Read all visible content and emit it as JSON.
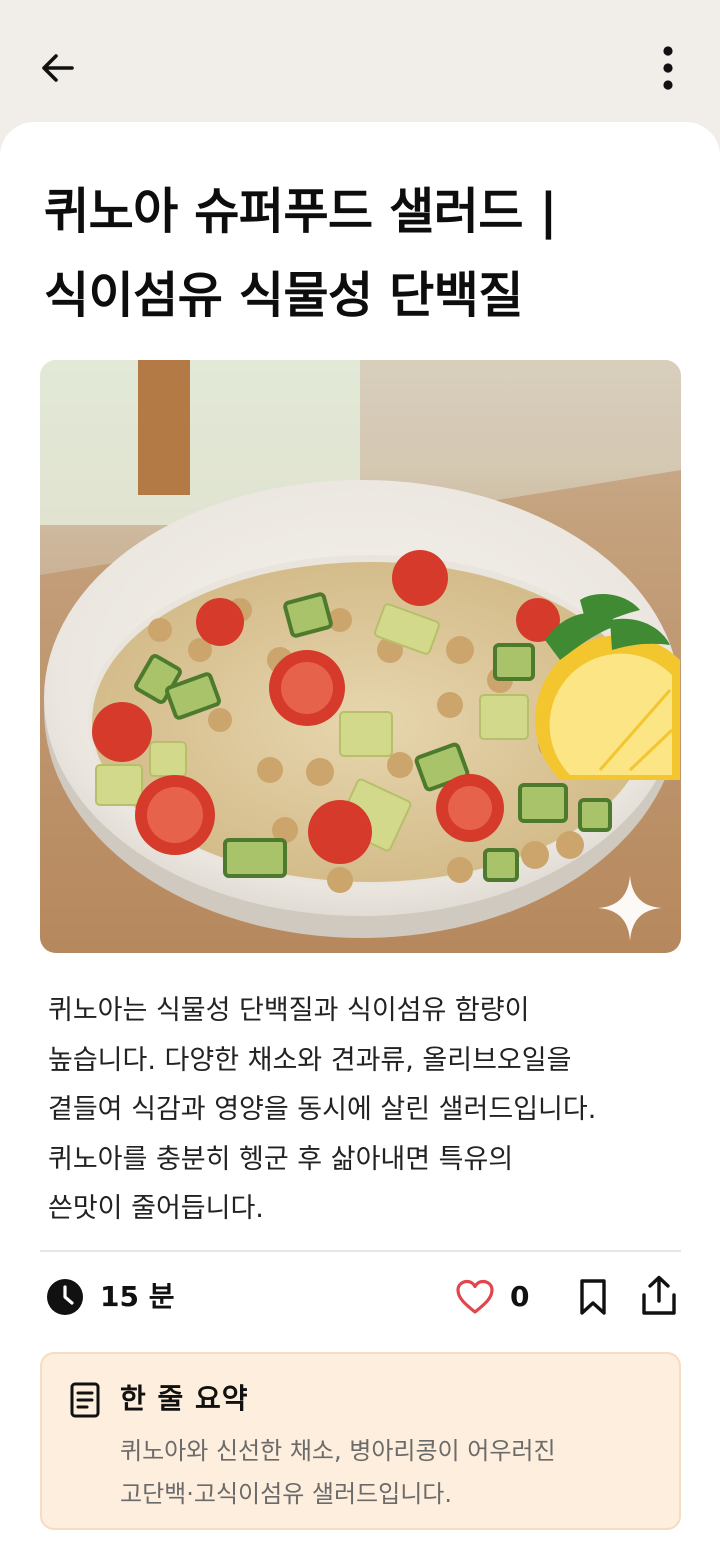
{
  "header": {
    "back_icon": "arrow-left-icon",
    "more_icon": "more-vertical-icon"
  },
  "recipe": {
    "title_line1": "퀴노아 슈퍼푸드 샐러드 |",
    "title_line2": "식이섬유 식물성 단백질",
    "image_icon": "sparkle-icon",
    "description": [
      "퀴노아는 식물성 단백질과 식이섬유 함량이",
      "높습니다. 다양한 채소와 견과류, 올리브오일을",
      "곁들여 식감과 영양을 동시에 살린 샐러드입니다.",
      "퀴노아를 충분히 헹군 후 삶아내면 특유의",
      "쓴맛이 줄어듭니다."
    ]
  },
  "meta": {
    "time": "15 분",
    "likes": "0",
    "icons": [
      "clock-icon",
      "heart-icon",
      "bookmark-icon",
      "share-icon"
    ],
    "heart_color": "#e0464b"
  },
  "summary": {
    "title": "한 줄 요약",
    "text_line1": "퀴노아와 신선한 채소, 병아리콩이 어우러진",
    "text_line2": "고단백·고식이섬유 샐러드입니다.",
    "icon": "document-icon",
    "background": "#fdeedd"
  }
}
